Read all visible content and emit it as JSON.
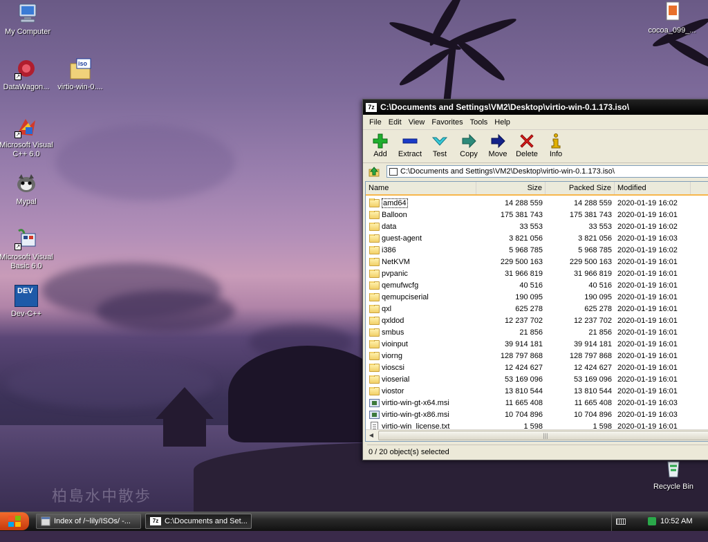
{
  "desktop": {
    "icons": [
      {
        "label": "My Computer",
        "icon": "my-computer-icon"
      },
      {
        "label": "DataWagon...",
        "icon": "datawagon-icon"
      },
      {
        "label": "virtio-win-0....",
        "icon": "iso-file-icon",
        "badge": "iso"
      },
      {
        "label": "Microsoft Visual C++ 6.0",
        "icon": "visual-cpp-icon"
      },
      {
        "label": "Mypal",
        "icon": "mypal-icon"
      },
      {
        "label": "Microsoft Visual Basic 6.0",
        "icon": "visual-basic-icon"
      },
      {
        "label": "Dev-C++",
        "icon": "devcpp-icon",
        "badge": "DEV"
      },
      {
        "label": "cocoa_099_...",
        "icon": "cocoa-file-icon"
      },
      {
        "label": "Recycle Bin",
        "icon": "recycle-bin-icon"
      }
    ],
    "wallpaper_text": "柏島水中散歩"
  },
  "window": {
    "app_icon_text": "7z",
    "title": "C:\\Documents and Settings\\VM2\\Desktop\\virtio-win-0.1.173.iso\\",
    "menu": [
      "File",
      "Edit",
      "View",
      "Favorites",
      "Tools",
      "Help"
    ],
    "toolbar": {
      "add": "Add",
      "extract": "Extract",
      "test": "Test",
      "copy": "Copy",
      "move": "Move",
      "delete": "Delete",
      "info": "Info"
    },
    "address": "C:\\Documents and Settings\\VM2\\Desktop\\virtio-win-0.1.173.iso\\",
    "columns": {
      "name": "Name",
      "size": "Size",
      "packed": "Packed Size",
      "modified": "Modified"
    },
    "files": [
      {
        "name": "amd64",
        "type": "folder",
        "size": "14 288 559",
        "packed": "14 288 559",
        "modified": "2020-01-19 16:02"
      },
      {
        "name": "Balloon",
        "type": "folder",
        "size": "175 381 743",
        "packed": "175 381 743",
        "modified": "2020-01-19 16:01"
      },
      {
        "name": "data",
        "type": "folder",
        "size": "33 553",
        "packed": "33 553",
        "modified": "2020-01-19 16:02"
      },
      {
        "name": "guest-agent",
        "type": "folder",
        "size": "3 821 056",
        "packed": "3 821 056",
        "modified": "2020-01-19 16:03"
      },
      {
        "name": "i386",
        "type": "folder",
        "size": "5 968 785",
        "packed": "5 968 785",
        "modified": "2020-01-19 16:02"
      },
      {
        "name": "NetKVM",
        "type": "folder",
        "size": "229 500 163",
        "packed": "229 500 163",
        "modified": "2020-01-19 16:01"
      },
      {
        "name": "pvpanic",
        "type": "folder",
        "size": "31 966 819",
        "packed": "31 966 819",
        "modified": "2020-01-19 16:01"
      },
      {
        "name": "qemufwcfg",
        "type": "folder",
        "size": "40 516",
        "packed": "40 516",
        "modified": "2020-01-19 16:01"
      },
      {
        "name": "qemupciserial",
        "type": "folder",
        "size": "190 095",
        "packed": "190 095",
        "modified": "2020-01-19 16:01"
      },
      {
        "name": "qxl",
        "type": "folder",
        "size": "625 278",
        "packed": "625 278",
        "modified": "2020-01-19 16:01"
      },
      {
        "name": "qxldod",
        "type": "folder",
        "size": "12 237 702",
        "packed": "12 237 702",
        "modified": "2020-01-19 16:01"
      },
      {
        "name": "smbus",
        "type": "folder",
        "size": "21 856",
        "packed": "21 856",
        "modified": "2020-01-19 16:01"
      },
      {
        "name": "vioinput",
        "type": "folder",
        "size": "39 914 181",
        "packed": "39 914 181",
        "modified": "2020-01-19 16:01"
      },
      {
        "name": "viorng",
        "type": "folder",
        "size": "128 797 868",
        "packed": "128 797 868",
        "modified": "2020-01-19 16:01"
      },
      {
        "name": "vioscsi",
        "type": "folder",
        "size": "12 424 627",
        "packed": "12 424 627",
        "modified": "2020-01-19 16:01"
      },
      {
        "name": "vioserial",
        "type": "folder",
        "size": "53 169 096",
        "packed": "53 169 096",
        "modified": "2020-01-19 16:01"
      },
      {
        "name": "viostor",
        "type": "folder",
        "size": "13 810 544",
        "packed": "13 810 544",
        "modified": "2020-01-19 16:01"
      },
      {
        "name": "virtio-win-gt-x64.msi",
        "type": "msi",
        "size": "11 665 408",
        "packed": "11 665 408",
        "modified": "2020-01-19 16:03"
      },
      {
        "name": "virtio-win-gt-x86.msi",
        "type": "msi",
        "size": "10 704 896",
        "packed": "10 704 896",
        "modified": "2020-01-19 16:03"
      },
      {
        "name": "virtio-win_license.txt",
        "type": "txt",
        "size": "1 598",
        "packed": "1 598",
        "modified": "2020-01-19 16:01"
      }
    ],
    "status": "0 / 20 object(s) selected"
  },
  "taskbar": {
    "tasks": [
      {
        "label": "Index of /~lily/ISOs/ -...",
        "icon": "browser-icon",
        "active": false
      },
      {
        "label": "C:\\Documents and Set...",
        "icon": "7zip-icon",
        "icon_text": "7z",
        "active": true
      }
    ],
    "clock": "10:52 AM"
  },
  "colors": {
    "header_underline": "#f7b64a",
    "titlebar": "#000000",
    "taskbar": "#2a2a2a"
  }
}
